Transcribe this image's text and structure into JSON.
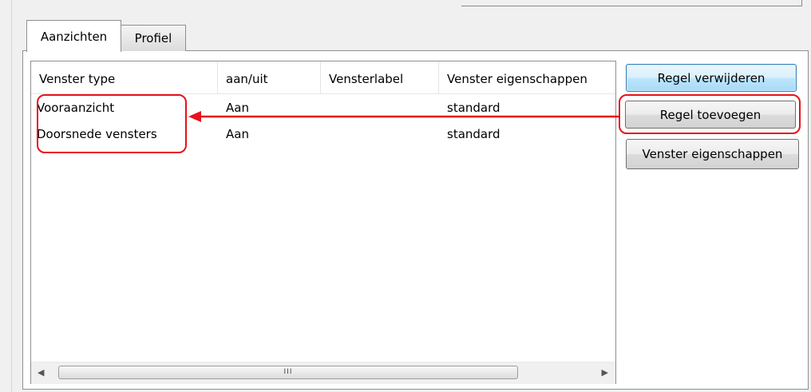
{
  "tabs": [
    {
      "label": "Aanzichten",
      "active": true
    },
    {
      "label": "Profiel",
      "active": false
    }
  ],
  "table": {
    "columns": [
      "Venster type",
      "aan/uit",
      "Vensterlabel",
      "Venster eigenschappen"
    ],
    "rows": [
      {
        "type": "Vooraanzicht",
        "onoff": "Aan",
        "label": "",
        "properties": "standard"
      },
      {
        "type": "Doorsnede vensters",
        "onoff": "Aan",
        "label": "",
        "properties": "standard"
      }
    ],
    "scrollbar_grip": "III"
  },
  "buttons": {
    "remove": "Regel verwijderen",
    "add": "Regel toevoegen",
    "properties": "Venster eigenschappen"
  },
  "annotation": {
    "color": "#e8111b"
  }
}
